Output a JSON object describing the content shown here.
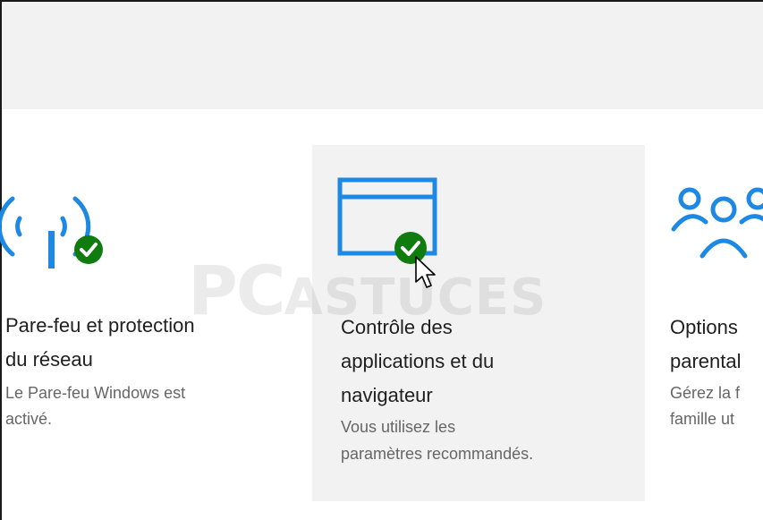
{
  "cards": [
    {
      "id": "firewall",
      "title_line1": "Pare-feu et protection",
      "title_line2": "du réseau",
      "desc_line1": "Le Pare-feu Windows est",
      "desc_line2": "activé.",
      "icon": "wireless-antenna-icon",
      "status_icon": "checkmark-badge-icon"
    },
    {
      "id": "app-browser",
      "title_line1": "Contrôle des",
      "title_line2": "applications et du",
      "title_line3": "navigateur",
      "desc_line1": "Vous utilisez les",
      "desc_line2": "paramètres recommandés.",
      "icon": "browser-window-icon",
      "status_icon": "checkmark-badge-icon",
      "selected": true
    },
    {
      "id": "family",
      "title_line1": "Options",
      "title_line2": "parental",
      "desc_line1": "Gérez la f",
      "desc_line2": "famille ut",
      "icon": "family-people-icon"
    }
  ],
  "watermark": {
    "part1": "PC",
    "part2": "ASTUCES"
  },
  "colors": {
    "accent_blue": "#1e88e5",
    "check_green": "#107c10",
    "tile_selected_bg": "#f2f2f2"
  }
}
